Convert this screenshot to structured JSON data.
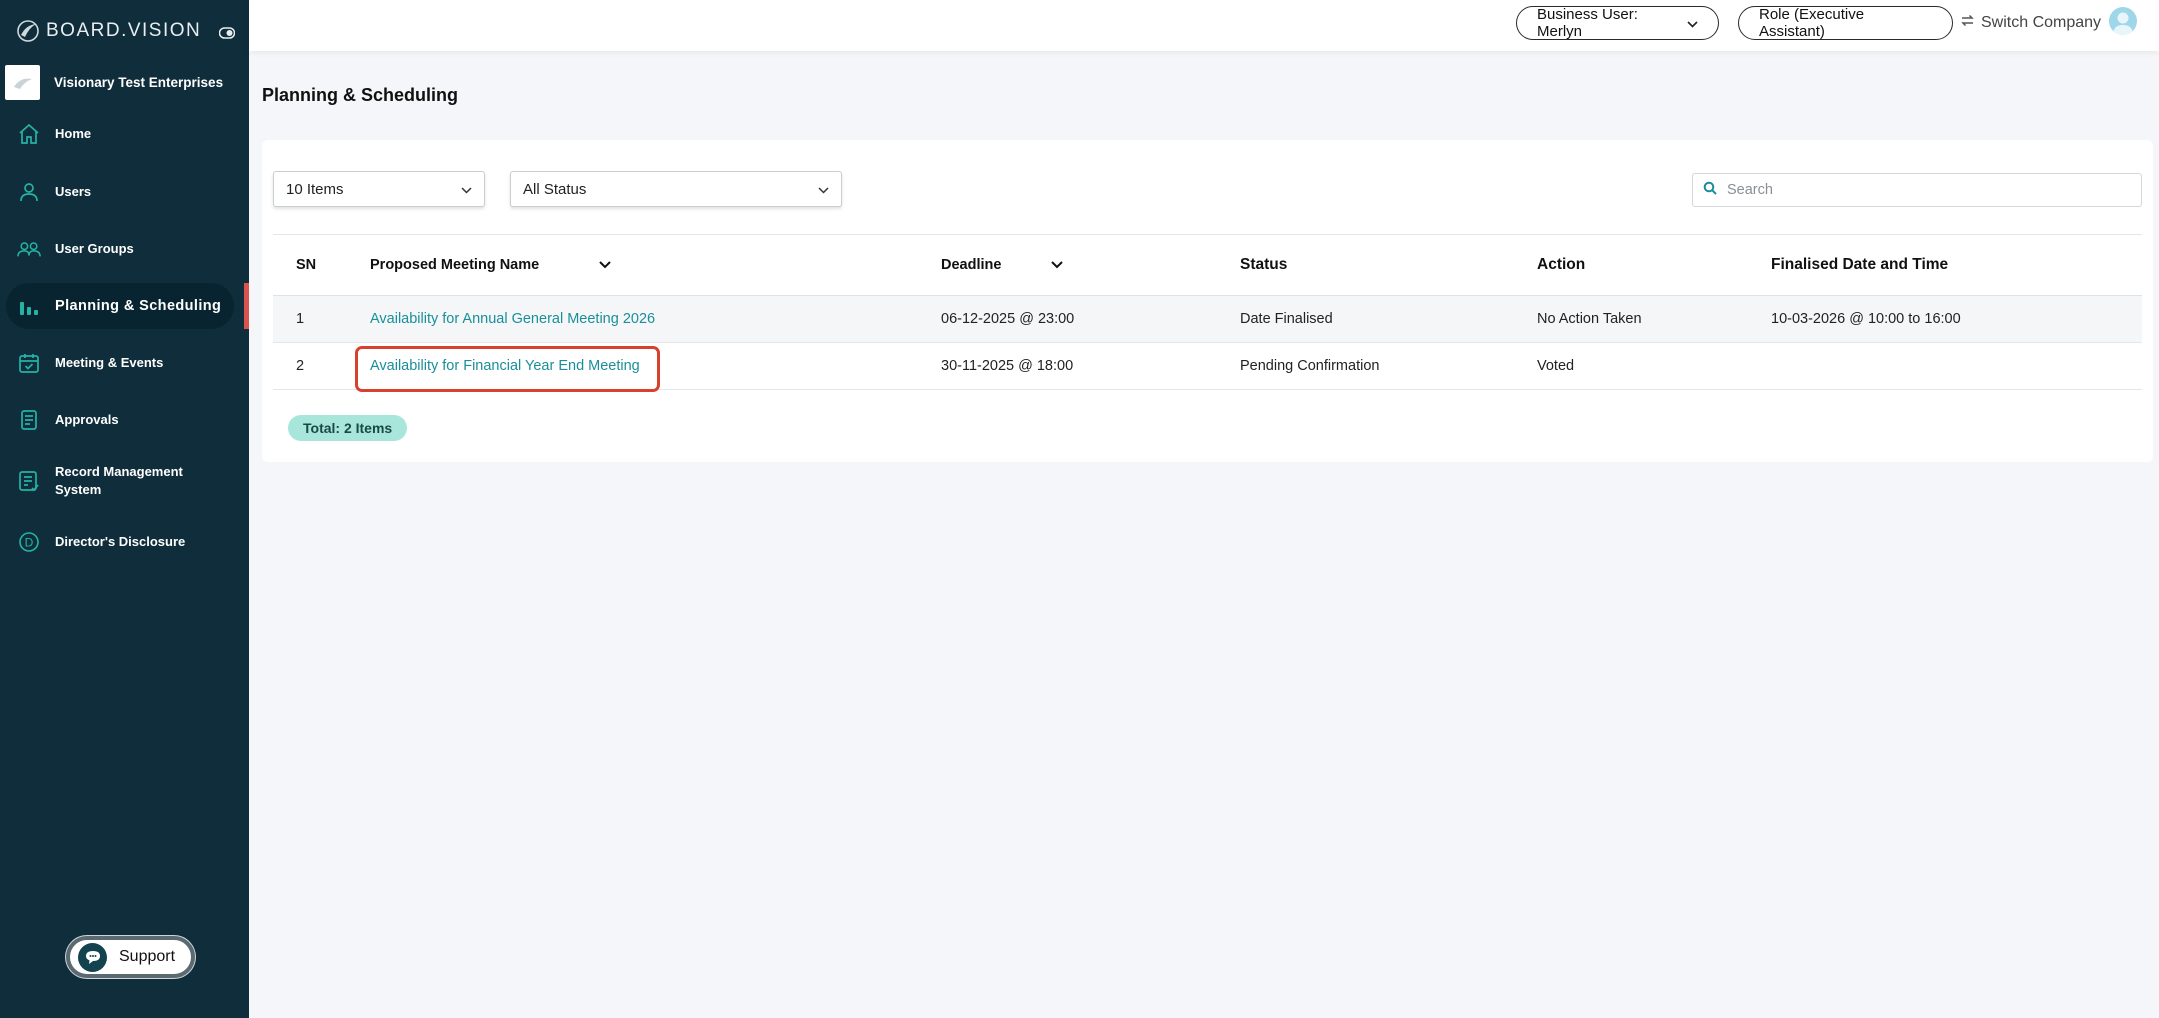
{
  "brand": {
    "name": "BOARD.VISION"
  },
  "company": {
    "name": "Visionary Test Enterprises"
  },
  "sidebar": {
    "items": [
      {
        "label": "Home",
        "icon": "home-icon"
      },
      {
        "label": "Users",
        "icon": "user-icon"
      },
      {
        "label": "User Groups",
        "icon": "users-icon"
      },
      {
        "label": "Planning & Scheduling",
        "icon": "bar-chart-icon",
        "active": true
      },
      {
        "label": "Meeting & Events",
        "icon": "calendar-check-icon"
      },
      {
        "label": "Approvals",
        "icon": "document-icon"
      },
      {
        "label": "Record Management System",
        "icon": "record-icon"
      },
      {
        "label": "Director's Disclosure",
        "icon": "d-circle-icon"
      }
    ],
    "support_label": "Support"
  },
  "topbar": {
    "business_user": "Business User: Merlyn",
    "role": "Role (Executive Assistant)",
    "switch_company": "Switch Company"
  },
  "page": {
    "title": "Planning & Scheduling"
  },
  "filters": {
    "items_per_page": "10 Items",
    "status": "All Status",
    "search_placeholder": "Search"
  },
  "table": {
    "headers": {
      "sn": "SN",
      "name": "Proposed Meeting Name",
      "deadline": "Deadline",
      "status": "Status",
      "action": "Action",
      "finalised": "Finalised Date and Time"
    },
    "rows": [
      {
        "sn": "1",
        "name": "Availability for Annual General Meeting 2026",
        "deadline": "06-12-2025 @ 23:00",
        "status": "Date Finalised",
        "action": "No Action Taken",
        "finalised": "10-03-2026 @ 10:00 to 16:00"
      },
      {
        "sn": "2",
        "name": "Availability for Financial Year End Meeting",
        "deadline": "30-11-2025 @ 18:00",
        "status": "Pending Confirmation",
        "action": "Voted",
        "finalised": ""
      }
    ],
    "total": "Total: 2 Items"
  },
  "colors": {
    "sidebar_bg": "#0f2d3a",
    "accent_teal": "#1a8f99",
    "highlight_red": "#d8402f",
    "badge_bg": "#a8e6dc"
  }
}
